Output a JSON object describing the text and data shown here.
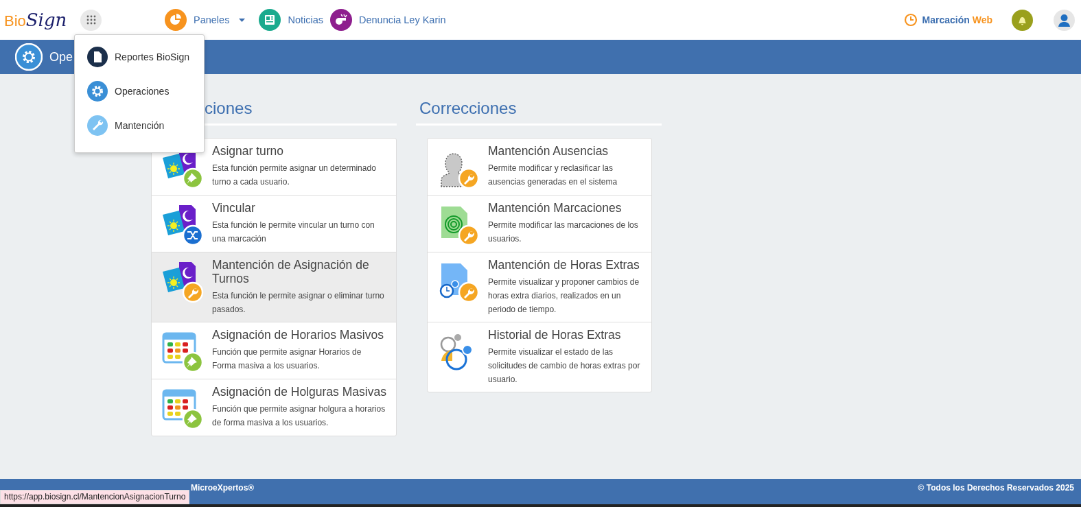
{
  "logo": {
    "part_1": "Bio",
    "part_2": "Sign"
  },
  "nav": [
    {
      "label": "Paneles",
      "kind": "panels",
      "dropdown": true
    },
    {
      "label": "Noticias",
      "kind": "news"
    },
    {
      "label": "Denuncia Ley Karin",
      "kind": "whistle"
    }
  ],
  "clock_link": {
    "label": "Marcación",
    "accent": "Web"
  },
  "title_bar": {
    "title": "Ope"
  },
  "apps_menu": {
    "items": [
      {
        "label": "Reportes BioSign",
        "kind": "reports"
      },
      {
        "label": "Operaciones",
        "kind": "operations"
      },
      {
        "label": "Mantención",
        "kind": "maintenance"
      }
    ]
  },
  "sections": [
    {
      "heading": "ciones",
      "cards": [
        {
          "kind": "assign",
          "title": "Asignar turno",
          "description": "Esta función permite asignar un determinado turno a cada usuario.",
          "hovered": false
        },
        {
          "kind": "link",
          "title": "Vincular",
          "description": "Esta función le permite vincular un turno con una marcación",
          "hovered": false
        },
        {
          "kind": "maintain",
          "title": "Mantención de Asignación de Turnos",
          "description": "Esta función le permite asignar o eliminar turno pasados.",
          "hovered": true
        },
        {
          "kind": "schedules",
          "title": "Asignación de Horarios Masivos",
          "description": "Función que permite asignar Horarios de Forma masiva a los usuarios.",
          "hovered": false
        },
        {
          "kind": "tolerances",
          "title": "Asignación de Holguras Masivas",
          "description": "Función que permite asignar holgura a horarios de forma masiva a los usuarios.",
          "hovered": false
        }
      ]
    },
    {
      "heading": "Correcciones",
      "cards": [
        {
          "kind": "absences",
          "title": "Mantención Ausencias",
          "description": "Permite modificar y reclasificar las ausencias generadas en el sistema",
          "hovered": false
        },
        {
          "kind": "punches",
          "title": "Mantención Marcaciones",
          "description": "Permite modificar las marcaciones de los usuarios.",
          "hovered": false
        },
        {
          "kind": "overtime",
          "title": "Mantención de Horas Extras",
          "description": "Permite visualizar y proponer cambios de horas extra diarios, realizados en un periodo de tiempo.",
          "hovered": false
        },
        {
          "kind": "history",
          "title": "Historial de Horas Extras",
          "description": "Permite visualizar el estado de las solicitudes de cambio de horas extras por usuario.",
          "hovered": false
        }
      ]
    }
  ],
  "footer": {
    "left": "MicroeXpertos®",
    "right": "© Todos los Derechos Reservados 2025"
  },
  "status_url": "https://app.biosign.cl/MantencionAsignacionTurno"
}
